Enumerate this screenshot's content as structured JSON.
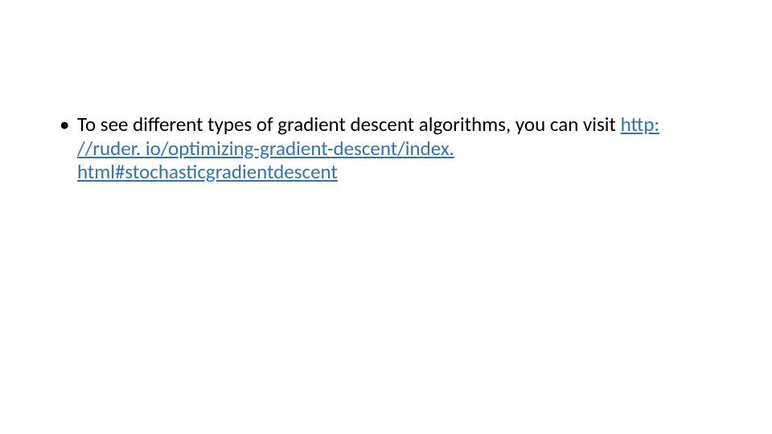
{
  "slide": {
    "bullet_text": "To see different types of gradient descent algorithms, you can visit ",
    "link_text": "http: //ruder. io/optimizing-gradient-descent/index. html#stochasticgradientdescent"
  }
}
